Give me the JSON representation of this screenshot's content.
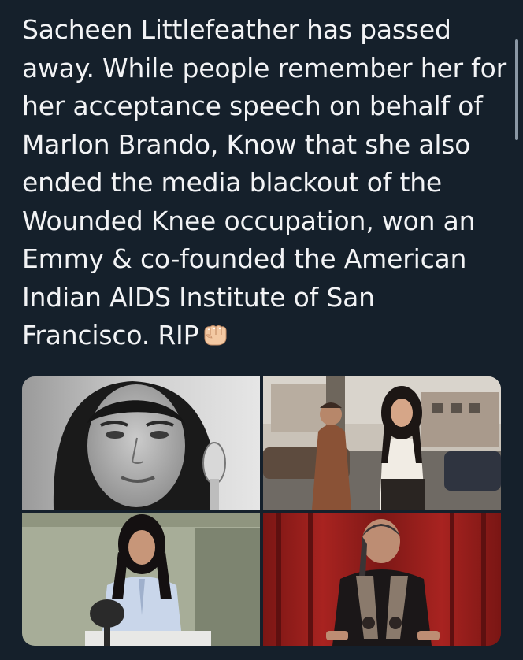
{
  "tweet": {
    "text_lines": [
      "Sacheen Littlefeather has passed",
      "away. While people remember her for",
      "her acceptance speech on behalf of",
      "Marlon Brando, Know that she also",
      "ended the media blackout of the",
      "Wounded Knee occupation, won an",
      "Emmy & co-founded the American",
      "Indian AIDS Institute of San",
      "Francisco. RIP"
    ],
    "emoji": "oncoming-fist-emoji"
  },
  "media": {
    "photos": [
      {
        "name": "portrait-photo"
      },
      {
        "name": "street-photo"
      },
      {
        "name": "interview-photo"
      },
      {
        "name": "stage-photo"
      }
    ]
  },
  "colors": {
    "background": "#15202b",
    "text": "#f2f3f5"
  }
}
